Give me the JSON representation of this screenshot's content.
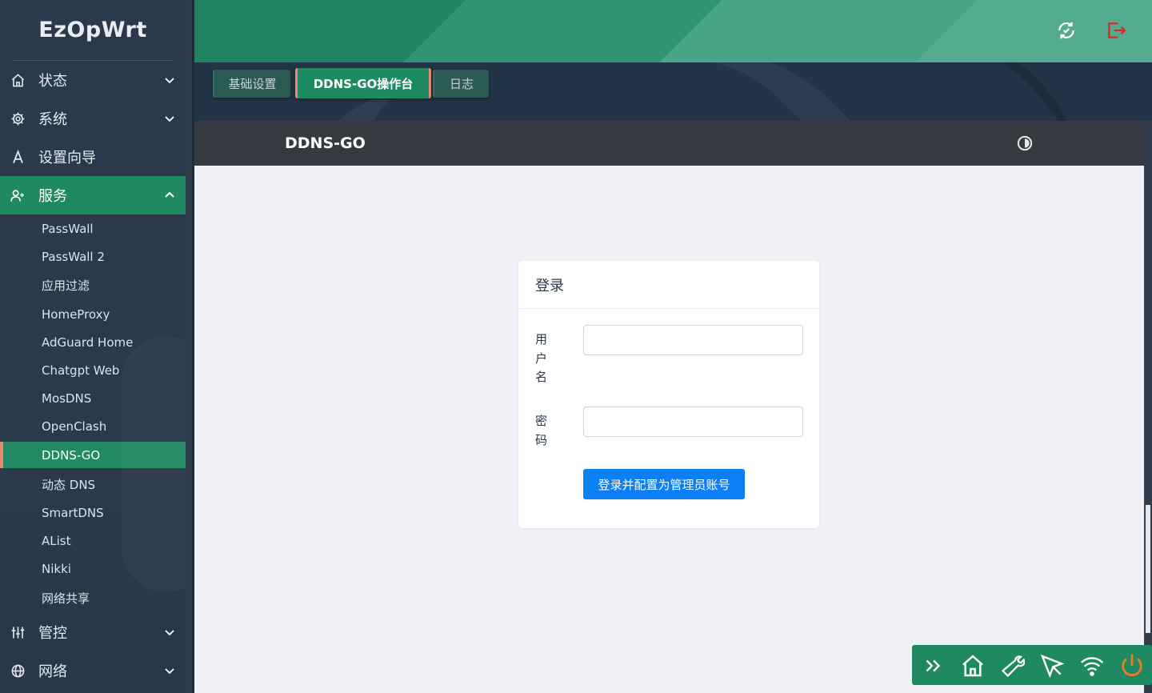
{
  "app": {
    "brand": "EzOpWrt"
  },
  "sidebar": {
    "groups": [
      {
        "label": "状态",
        "icon": "home-icon"
      },
      {
        "label": "系统",
        "icon": "gear-icon"
      },
      {
        "label": "设置向导",
        "icon": "wizard-icon"
      },
      {
        "label": "服务",
        "icon": "user-plus-icon"
      },
      {
        "label": "管控",
        "icon": "sliders-icon"
      },
      {
        "label": "网络",
        "icon": "globe-icon"
      }
    ],
    "services": [
      "PassWall",
      "PassWall 2",
      "应用过滤",
      "HomeProxy",
      "AdGuard Home",
      "Chatgpt Web",
      "MosDNS",
      "OpenClash",
      "DDNS-GO",
      "动态 DNS",
      "SmartDNS",
      "AList",
      "Nikki",
      "网络共享"
    ],
    "active_service": "DDNS-GO"
  },
  "tabs": [
    "基础设置",
    "DDNS-GO操作台",
    "日志"
  ],
  "panel": {
    "title": "DDNS-GO"
  },
  "login": {
    "title": "登录",
    "username_label": "用户名",
    "password_label": "密码",
    "username_value": "",
    "password_value": "",
    "submit_label": "登录并配置为管理员账号"
  },
  "colors": {
    "accent_green": "#1f8a62",
    "active_marker": "#e98c74",
    "primary_button": "#0d7ff4",
    "logout_red": "#e02424"
  }
}
